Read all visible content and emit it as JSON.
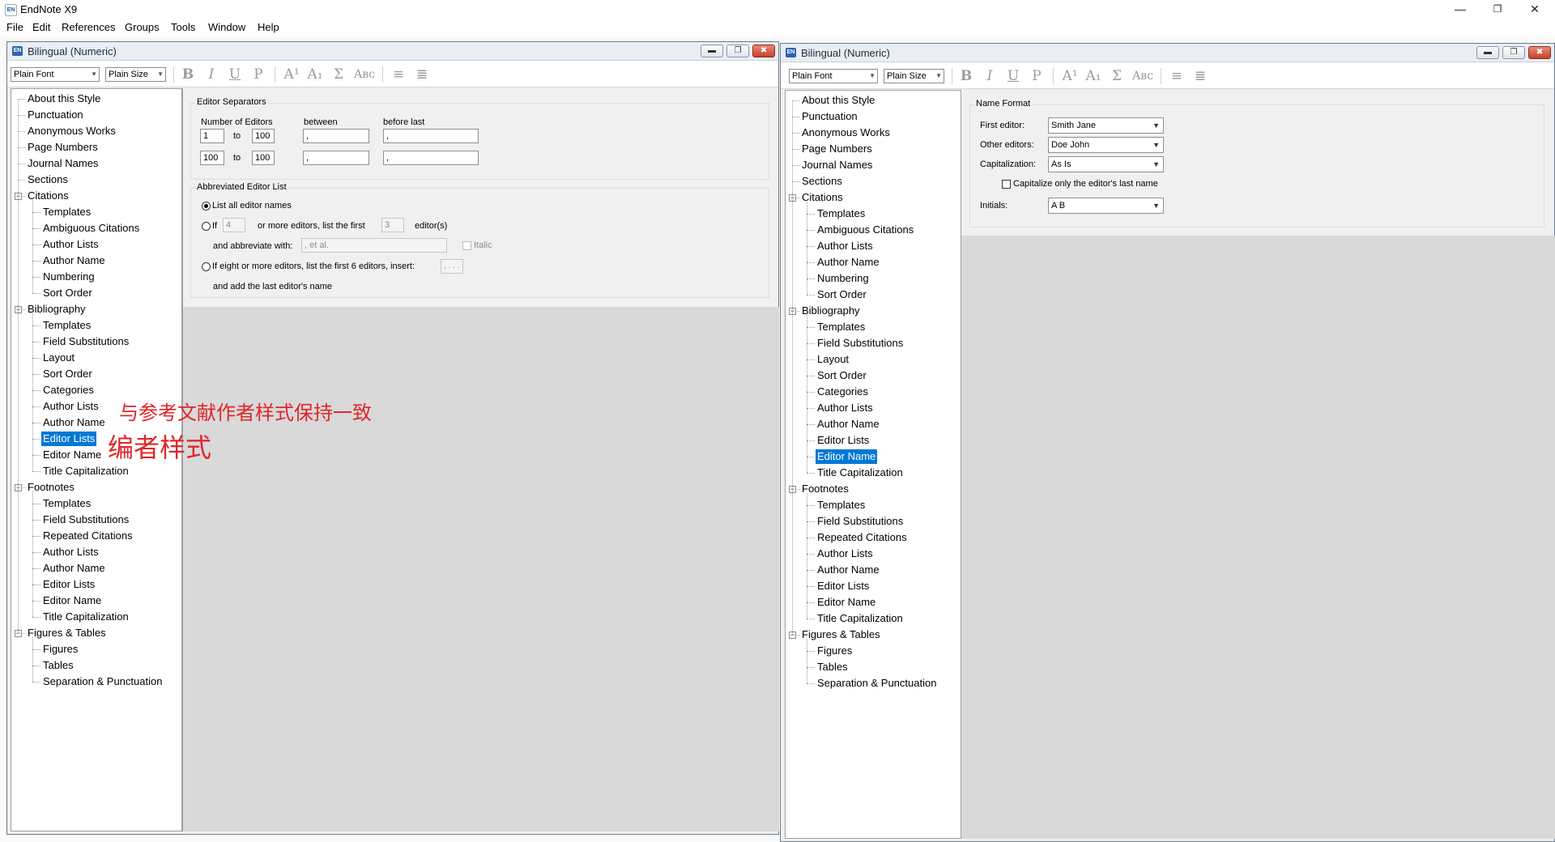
{
  "app": {
    "title": "EndNote X9",
    "icon_text": "EN"
  },
  "window_controls": {
    "minimize": "—",
    "restore": "❐",
    "close": "✕"
  },
  "menu": [
    "File",
    "Edit",
    "References",
    "Groups",
    "Tools",
    "Window",
    "Help"
  ],
  "child_window": {
    "title": "Bilingual (Numeric)",
    "buttons": {
      "minimize": "▬",
      "restore": "❐",
      "close": "✖"
    }
  },
  "toolbar": {
    "font": "Plain Font",
    "size": "Plain Size",
    "bold": "B",
    "italic": "I",
    "underline": "U",
    "plain": "P",
    "superscript": "A¹",
    "subscript": "A₁",
    "symbol": "Σ",
    "smallcaps": "Aʙᴄ",
    "align_left": "≡",
    "justify": "≣"
  },
  "tree_left": [
    "About this Style",
    "Punctuation",
    "Anonymous Works",
    "Page Numbers",
    "Journal Names",
    "Sections",
    "Citations",
    "Templates",
    "Ambiguous Citations",
    "Author Lists",
    "Author Name",
    "Numbering",
    "Sort Order",
    "Bibliography",
    "Templates",
    "Field Substitutions",
    "Layout",
    "Sort Order",
    "Categories",
    "Author Lists",
    "Author Name",
    "Editor Lists",
    "Editor Name",
    "Title Capitalization",
    "Footnotes",
    "Templates",
    "Field Substitutions",
    "Repeated Citations",
    "Author Lists",
    "Author Name",
    "Editor Lists",
    "Editor Name",
    "Title Capitalization",
    "Figures & Tables",
    "Figures",
    "Tables",
    "Separation & Punctuation"
  ],
  "left_selected": "Editor Lists",
  "right_selected": "Editor Name",
  "editor_separators": {
    "group_label": "Editor Separators",
    "col_number": "Number of Editors",
    "col_between": "between",
    "col_before_last": "before last",
    "to": "to",
    "rows": [
      {
        "from": "1",
        "to": "100",
        "between": ",",
        "before_last": ","
      },
      {
        "from": "100",
        "to": "100",
        "between": ",",
        "before_last": ","
      }
    ]
  },
  "abbreviated_editor_list": {
    "group_label": "Abbreviated Editor List",
    "opt_all": "List all editor names",
    "opt_if": "If",
    "if_count": "4",
    "or_more": "or more editors, list the first",
    "first_count": "3",
    "editors_suffix": "editor(s)",
    "abbreviate_with": "and abbreviate with:",
    "abbrev_value": ", et al.",
    "italic": "Italic",
    "opt_eight": "If eight or more editors, list the first 6 editors, insert:",
    "eight_value": ", . . .",
    "last_editor": "and add the last editor's name"
  },
  "name_format": {
    "group_label": "Name Format",
    "first_editor_label": "First editor:",
    "first_editor_value": "Smith Jane",
    "other_editors_label": "Other editors:",
    "other_editors_value": "Doe John",
    "capitalization_label": "Capitalization:",
    "capitalization_value": "As Is",
    "cap_last_name": "Capitalize only the editor's last name",
    "initials_label": "Initials:",
    "initials_value": "A B"
  },
  "annotations": {
    "line1": "与参考文献作者样式保持一致",
    "line2": "编者样式",
    "color": "#e0262a"
  }
}
